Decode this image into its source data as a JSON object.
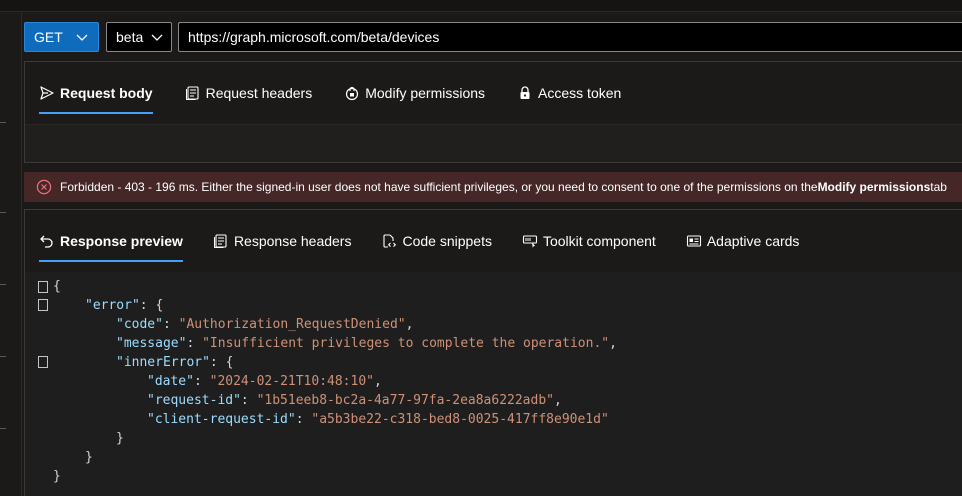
{
  "query": {
    "method": "GET",
    "version": "beta",
    "url": "https://graph.microsoft.com/beta/devices"
  },
  "request_tabs": [
    {
      "label": "Request body",
      "icon": "send-icon",
      "active": true
    },
    {
      "label": "Request headers",
      "icon": "document-icon",
      "active": false
    },
    {
      "label": "Modify permissions",
      "icon": "shield-lock-icon",
      "active": false
    },
    {
      "label": "Access token",
      "icon": "lock-icon",
      "active": false
    }
  ],
  "error": {
    "icon": "error-circle-icon",
    "text_before": "Forbidden - 403 - 196 ms. Either the signed-in user does not have sufficient privileges, or you need to consent to one of the permissions on the ",
    "link_text": "Modify permissions",
    "text_after": " tab"
  },
  "response_tabs": [
    {
      "label": "Response preview",
      "icon": "undo-arrow-icon",
      "active": true
    },
    {
      "label": "Response headers",
      "icon": "document-icon",
      "active": false
    },
    {
      "label": "Code snippets",
      "icon": "code-doc-icon",
      "active": false
    },
    {
      "label": "Toolkit component",
      "icon": "toolkit-icon",
      "active": false
    },
    {
      "label": "Adaptive cards",
      "icon": "card-icon",
      "active": false
    }
  ],
  "response": {
    "open_brace": "{",
    "error_key": "\"error\"",
    "code_key": "\"code\"",
    "code_value": "\"Authorization_RequestDenied\"",
    "message_key": "\"message\"",
    "message_value": "\"Insufficient privileges to complete the operation.\"",
    "inner_key": "\"innerError\"",
    "date_key": "\"date\"",
    "date_value": "\"2024-02-21T10:48:10\"",
    "request_id_key": "\"request-id\"",
    "request_id_value": "\"1b51eeb8-bc2a-4a77-97fa-2ea8a6222adb\"",
    "client_request_id_key": "\"client-request-id\"",
    "client_request_id_value": "\"a5b3be22-c318-bed8-0025-417ff8e90e1d\"",
    "close_brace": "}"
  },
  "colors": {
    "accent": "#0f6cbd",
    "tab_underline": "#479ef5",
    "error_bg": "#442726",
    "error_icon": "#f1707b",
    "json_key": "#9cdcfe",
    "json_string": "#ce9178"
  }
}
